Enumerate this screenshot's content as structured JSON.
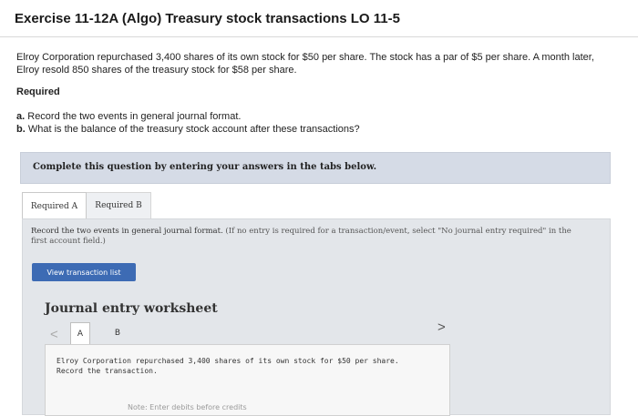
{
  "exercise": {
    "title": "Exercise 11-12A (Algo) Treasury stock transactions LO 11-5",
    "problem_line1": "Elroy Corporation repurchased 3,400 shares of its own stock for $50 per share. The stock has a par of $5 per share. A month later,",
    "problem_line2": "Elroy resold 850 shares of the treasury stock for $58 per share.",
    "required_heading": "Required",
    "req_a_label": "a.",
    "req_a_text": "Record the two events in general journal format.",
    "req_b_label": "b.",
    "req_b_text": "What is the balance of the treasury stock account after these transactions?"
  },
  "instructions": {
    "banner": "Complete this question by entering your answers in the tabs below."
  },
  "tabs": {
    "a": "Required A",
    "b": "Required B"
  },
  "panel": {
    "instruction": "Record the two events in general journal format.",
    "note_line1": "(If no entry is required for a transaction/event, select \"No journal entry required\" in the",
    "note_line2": "first account field.)",
    "view_button": "View transaction list"
  },
  "worksheet": {
    "title": "Journal entry worksheet",
    "tab_a": "A",
    "tab_b": "B",
    "nav_prev": "<",
    "nav_next": ">",
    "desc_line1": "Elroy Corporation repurchased 3,400 shares of its own stock for $50 per share.",
    "desc_line2": "Record the transaction.",
    "hint": "Note: Enter debits before credits"
  }
}
